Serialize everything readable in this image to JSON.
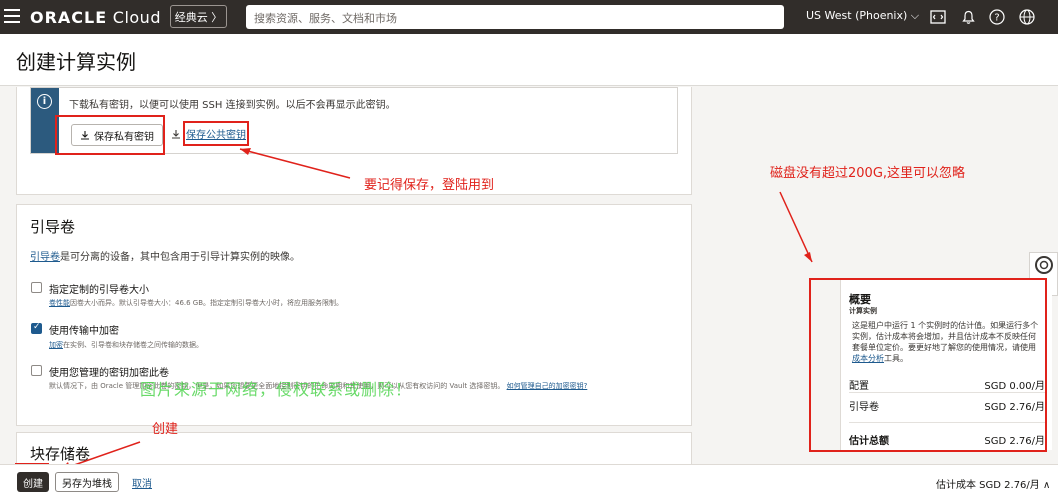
{
  "topbar": {
    "brand_main": "ORACLE",
    "brand_suffix": "Cloud",
    "classic_label": "经典云 〉",
    "search_placeholder": "搜索资源、服务、文档和市场",
    "region": "US West (Phoenix) ⌵"
  },
  "page": {
    "title": "创建计算实例"
  },
  "ssh": {
    "info": "下载私有密钥，以便可以使用 SSH 连接到实例。以后不会再显示此密钥。",
    "save_private": "保存私有密钥",
    "save_public": "保存公共密钥"
  },
  "boot_volume": {
    "title": "引导卷",
    "desc_link": "引导卷",
    "desc_rest": "是可分离的设备，其中包含用于引导计算实例的映像。",
    "custom_size_label": "指定定制的引导卷大小",
    "custom_size_help_link": "卷性能",
    "custom_size_help": "因卷大小而异。默认引导卷大小：46.6 GB。指定定制引导卷大小时，将应用服务限制。",
    "custom_size_checked": false,
    "transit_label": "使用传输中加密",
    "transit_help_link": "加密",
    "transit_help": "在实例、引导卷和块存储卷之间传输的数据。",
    "transit_checked": true,
    "own_key_label": "使用您管理的密钥加密此卷",
    "own_key_help": "默认情况下，由 Oracle 管理加密此卷的密钥，但是，如果您想要更全面地控制密钥的生命周期和其使用，则可以从您有权访问的 Vault 选择密钥。",
    "own_key_help_link": "如何管理自己的加密密钥?",
    "own_key_checked": false
  },
  "block_volume": {
    "title": "块存储卷"
  },
  "summary": {
    "title": "概要",
    "subtitle": "计算实例",
    "desc_1": "这是租户中运行 1 个实例时的估计值。如果运行多个实例，估计成本将会增加，并且估计成本不反映任何套餐单位定价。要更好地了解您的使用情况，请使用",
    "desc_link": "成本分析",
    "desc_2": "工具。",
    "rows": [
      {
        "label": "配置",
        "value": "SGD 0.00/月"
      },
      {
        "label": "引导卷",
        "value": "SGD 2.76/月"
      }
    ],
    "total_label": "估计总额",
    "total_value": "SGD 2.76/月"
  },
  "bottom": {
    "create": "创建",
    "save_stack": "另存为堆栈",
    "cancel": "取消",
    "est_cost": "估计成本  SGD 2.76/月 ∧"
  },
  "annotations": {
    "save_note": "要记得保存，登陆用到",
    "disk_note": "磁盘没有超过200G,这里可以忽略",
    "create_note": "创建",
    "watermark": "图片来源于网络，侵权联系或删除！"
  },
  "colors": {
    "topbar": "#312d2a",
    "link": "#1e5a8e",
    "annotation": "#e0221b"
  }
}
